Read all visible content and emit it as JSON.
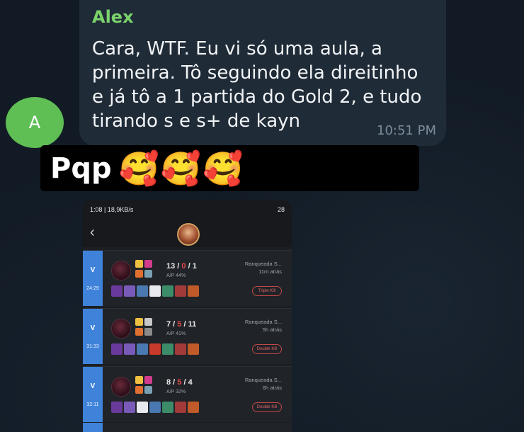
{
  "chat": {
    "avatar_letter": "A",
    "sender": "Alex",
    "message": "Cara, WTF. Eu vi só uma aula, a\nprimeira. Tô seguindo ela direitinho\ne já tô a 1 partida do Gold 2, e tudo\ntirando s e s+ de kayn",
    "time": "10:51 PM",
    "accent_color": "#7bd36b"
  },
  "sticker": {
    "text": "Pqp",
    "emojis": [
      "🥰",
      "🥰",
      "🥰",
      "😍",
      "😍",
      "😍",
      "😍"
    ]
  },
  "screenshot": {
    "status_left": "1:08 | 18,9KB/s",
    "status_right": "28",
    "back_icon": "chevron-left-icon",
    "matches": [
      {
        "result": "V",
        "duration": "24:29",
        "kills": "13",
        "deaths": "0",
        "assists": "1",
        "kp": "A/P 44%",
        "queue": "Ranqueada S...",
        "ago": "11m atrás",
        "badge": "Triple Kill"
      },
      {
        "result": "V",
        "duration": "31:33",
        "kills": "7",
        "deaths": "5",
        "assists": "11",
        "kp": "A/P 41%",
        "queue": "Ranqueada S...",
        "ago": "5h atrás",
        "badge": "Double Kill"
      },
      {
        "result": "V",
        "duration": "32:11",
        "kills": "8",
        "deaths": "5",
        "assists": "4",
        "kp": "A/P 32%",
        "queue": "Ranqueada S...",
        "ago": "6h atrás",
        "badge": "Double Kill"
      }
    ]
  }
}
